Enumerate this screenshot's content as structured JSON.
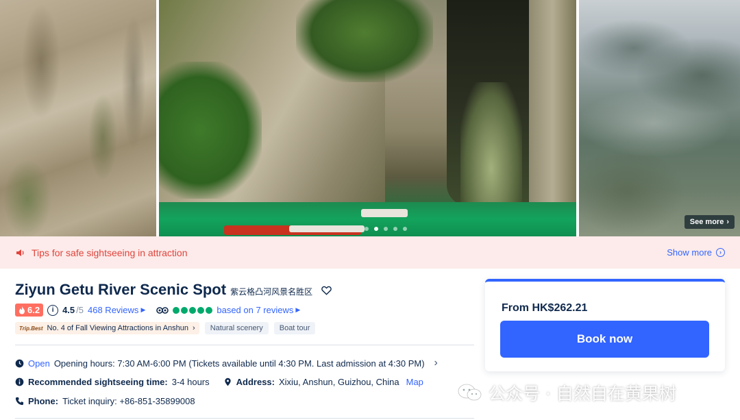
{
  "gallery": {
    "see_more_label": "See more",
    "slide_count": 5,
    "active_slide": 2
  },
  "tips": {
    "text": "Tips for safe sightseeing in attraction",
    "show_more_label": "Show more"
  },
  "attraction": {
    "title": "Ziyun Getu River Scenic Spot",
    "subtitle": "紫云格凸河风景名胜区",
    "hot_score": "6.2",
    "rating": "4.5",
    "rating_total": "/5",
    "reviews_label": "468 Reviews",
    "tripadvisor_bubbles": 5,
    "tripadvisor_text": "based on 7 reviews",
    "trip_best_label": "Trip.Best",
    "rank_text": "No. 4 of Fall Viewing Attractions in Anshun",
    "tags": [
      "Natural scenery",
      "Boat tour"
    ]
  },
  "details": {
    "open_status": "Open",
    "hours_text": "Opening hours: 7:30 AM-6:00 PM (Tickets available until 4:30 PM. Last admission at 4:30 PM)",
    "recommended_label": "Recommended sightseeing time:",
    "recommended_value": "3-4 hours",
    "address_label": "Address:",
    "address_value": "Xixiu, Anshun, Guizhou, China",
    "map_label": "Map",
    "phone_label": "Phone:",
    "phone_value": "Ticket inquiry: +86-851-35899008"
  },
  "booking": {
    "price_text": "From HK$262.21",
    "book_label": "Book now"
  },
  "watermark": {
    "text": "公众号 · 自然自在黄果树"
  },
  "colors": {
    "accent": "#3264ff",
    "tips_bg": "#fcebea",
    "tips_text": "#e0443c",
    "hot_badge": "#ff6f61",
    "tripadvisor_green": "#00aa6c",
    "text_primary": "#0f294d"
  },
  "icons": {
    "tips": "speaker-icon",
    "heart": "heart-icon",
    "fire": "fire-icon",
    "info": "info-icon",
    "tripadvisor": "owl-icon",
    "clock": "clock-icon",
    "location": "pin-icon",
    "phone": "phone-icon"
  }
}
